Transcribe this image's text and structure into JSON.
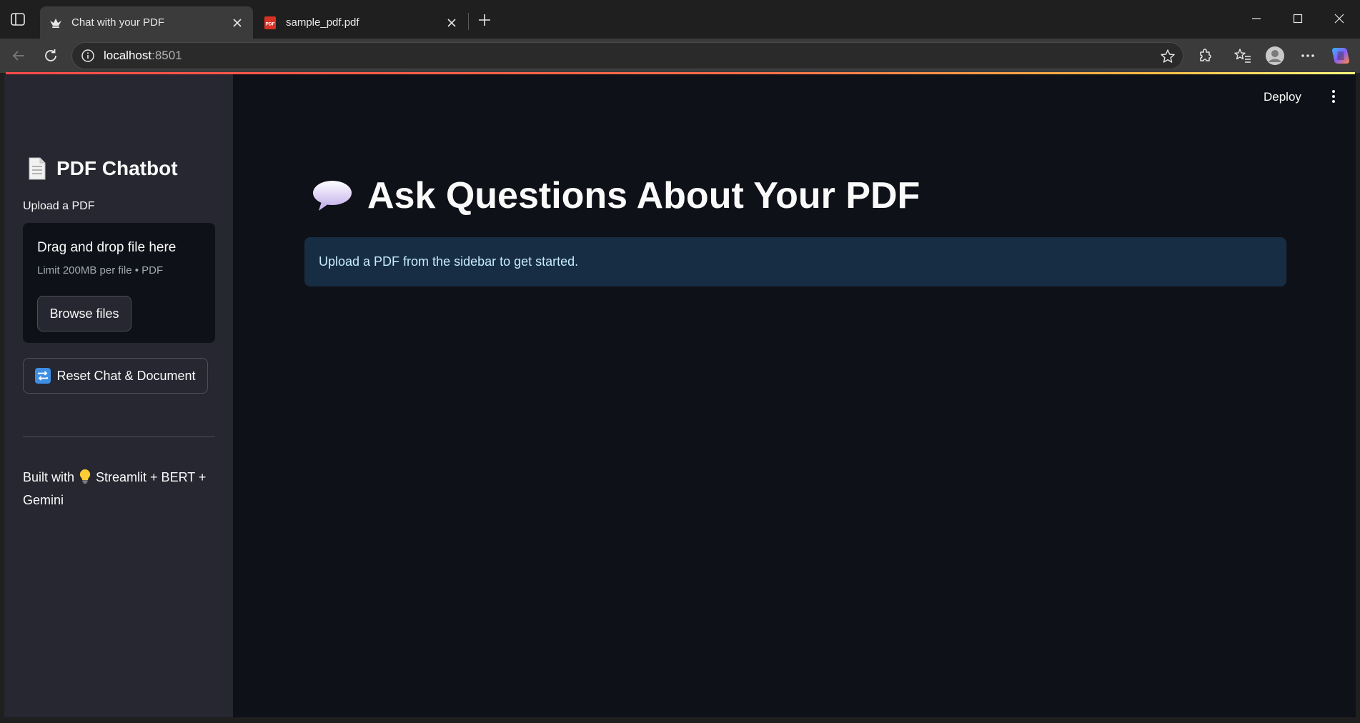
{
  "browser": {
    "tabs": [
      {
        "title": "Chat with your PDF",
        "active": true,
        "favicon": "streamlit-crown-icon"
      },
      {
        "title": "sample_pdf.pdf",
        "active": false,
        "favicon": "pdf-file-icon"
      }
    ],
    "address_host": "localhost",
    "address_port": ":8501"
  },
  "app": {
    "deploy_label": "Deploy",
    "sidebar": {
      "title": "PDF Chatbot",
      "title_icon": "page-icon",
      "uploader_label": "Upload a PDF",
      "dropzone_title": "Drag and drop file here",
      "dropzone_limit": "Limit 200MB per file • PDF",
      "browse_label": "Browse files",
      "reset_label": "Reset Chat & Document",
      "reset_icon": "repeat-icon",
      "footer_prefix": "Built with",
      "footer_icon": "light-bulb-icon",
      "footer_suffix": "Streamlit + BERT + Gemini"
    },
    "main": {
      "title": "Ask Questions About Your PDF",
      "title_icon": "speech-balloon-icon",
      "info_message": "Upload a PDF from the sidebar to get started."
    }
  },
  "colors": {
    "page_bg": "#0e1117",
    "sidebar_bg": "#262730",
    "info_bg": "#172d43",
    "info_text": "#c7ebff",
    "accent_red": "#ff4b4b"
  }
}
